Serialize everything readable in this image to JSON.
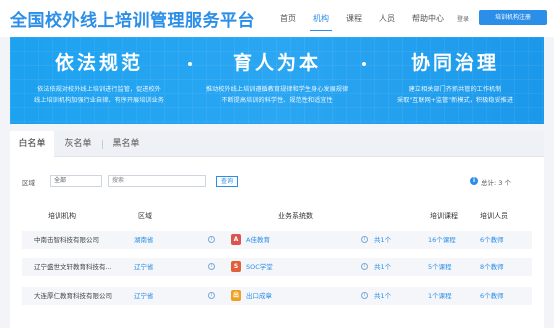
{
  "header": {
    "logo_text": "全国校外线上培训管理服务平台",
    "nav": [
      {
        "label": "首页",
        "active": false
      },
      {
        "label": "机构",
        "active": true
      },
      {
        "label": "课程",
        "active": false
      },
      {
        "label": "人员",
        "active": false
      },
      {
        "label": "帮助中心",
        "active": false
      }
    ],
    "login_label": "登录",
    "register_label": "培训机构注册"
  },
  "banner": {
    "pillars": [
      {
        "title": "依法规范",
        "lines": [
          "依法依规对校外线上培训进行监管，促进校外",
          "线上培训机构加强行业自律、有序开展培训业务"
        ]
      },
      {
        "title": "育人为本",
        "lines": [
          "推动校外线上培训遵循教育规律和学生身心发展规律",
          "不断提高培训的科学性、规范性和适宜性"
        ]
      },
      {
        "title": "协同治理",
        "lines": [
          "建立相关部门齐抓共管的工作机制",
          "采取\"互联网+监管\"新模式，积极稳妥推进"
        ]
      }
    ]
  },
  "tabs": [
    {
      "label": "白名单",
      "active": true
    },
    {
      "label": "灰名单",
      "active": false
    },
    {
      "label": "黑名单",
      "active": false
    }
  ],
  "filters": {
    "region_label": "区域",
    "region_value": "全部",
    "search_placeholder": "搜索",
    "query_label": "查询",
    "total_text": "总计: 3 个"
  },
  "table": {
    "headers": [
      "培训机构",
      "区域",
      "业务系统数",
      "培训课程",
      "培训人员"
    ],
    "rows": [
      {
        "org": "中南击智科技有限公司",
        "region": "湖南省",
        "system": "A佳教育",
        "system_count": "共1个",
        "courses": "16个课程",
        "staff": "6个教师",
        "logo_color": "#d9534f",
        "logo_glyph": "A"
      },
      {
        "org": "辽宁盛世文轩教育科技有...",
        "region": "辽宁省",
        "system": "SOC学堂",
        "system_count": "共1个",
        "courses": "5个课程",
        "staff": "8个教师",
        "logo_color": "#e0603a",
        "logo_glyph": "S"
      },
      {
        "org": "大连厚仁教育科技有限公司",
        "region": "辽宁省",
        "system": "出口成章",
        "system_count": "共1个",
        "courses": "1个课程",
        "staff": "6个教师",
        "logo_color": "#f0a020",
        "logo_glyph": "出"
      }
    ]
  }
}
